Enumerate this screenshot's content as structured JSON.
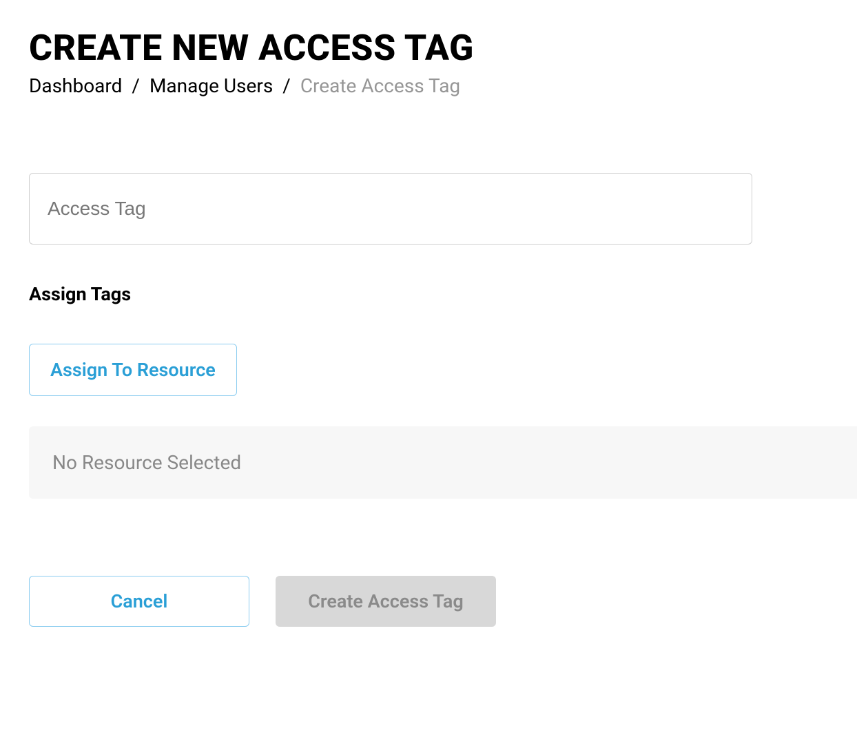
{
  "header": {
    "title": "CREATE NEW ACCESS TAG"
  },
  "breadcrumb": {
    "items": [
      {
        "label": "Dashboard",
        "current": false
      },
      {
        "label": "Manage Users",
        "current": false
      },
      {
        "label": "Create Access Tag",
        "current": true
      }
    ],
    "separator": "/"
  },
  "form": {
    "access_tag_placeholder": "Access Tag",
    "access_tag_value": ""
  },
  "assign": {
    "section_title": "Assign Tags",
    "assign_button_label": "Assign To Resource",
    "empty_state": "No Resource Selected"
  },
  "footer": {
    "cancel_label": "Cancel",
    "submit_label": "Create Access Tag"
  }
}
